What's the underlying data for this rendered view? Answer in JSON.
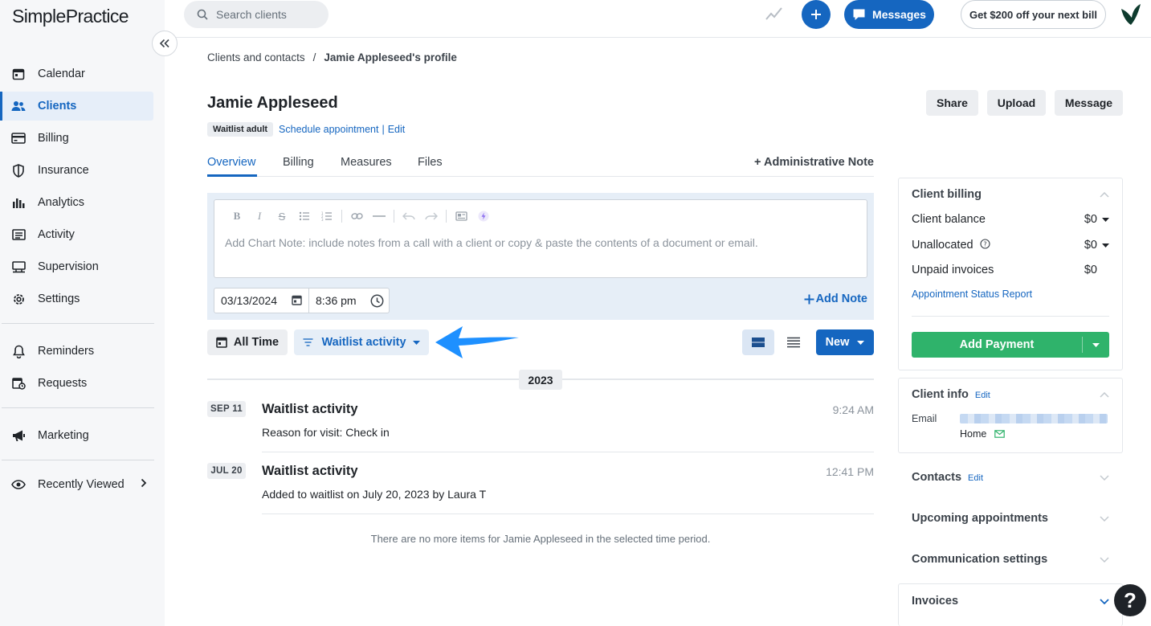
{
  "app": {
    "logo_text": "SimplePractice"
  },
  "topbar": {
    "search_placeholder": "Search clients",
    "messages_label": "Messages",
    "promo_label": "Get $200 off your next bill"
  },
  "sidebar": {
    "items": [
      {
        "label": "Calendar",
        "icon": "calendar-icon"
      },
      {
        "label": "Clients",
        "icon": "users-icon",
        "active": true
      },
      {
        "label": "Billing",
        "icon": "credit-card-icon"
      },
      {
        "label": "Insurance",
        "icon": "shield-icon"
      },
      {
        "label": "Analytics",
        "icon": "bar-chart-icon"
      },
      {
        "label": "Activity",
        "icon": "activity-list-icon"
      },
      {
        "label": "Supervision",
        "icon": "supervision-icon"
      },
      {
        "label": "Settings",
        "icon": "gear-icon"
      },
      {
        "label": "Reminders",
        "icon": "bell-icon"
      },
      {
        "label": "Requests",
        "icon": "requests-icon"
      },
      {
        "label": "Marketing",
        "icon": "megaphone-icon"
      },
      {
        "label": "Recently Viewed",
        "icon": "eye-icon"
      }
    ]
  },
  "breadcrumb": {
    "parent": "Clients and contacts",
    "separator": "/",
    "current": "Jamie Appleseed's profile"
  },
  "client": {
    "name": "Jamie Appleseed",
    "tag": "Waitlist adult",
    "schedule_link": "Schedule appointment",
    "edit_link": "Edit",
    "divider": "|"
  },
  "actions": {
    "share": "Share",
    "upload": "Upload",
    "message": "Message"
  },
  "tabs": [
    {
      "label": "Overview",
      "active": true
    },
    {
      "label": "Billing"
    },
    {
      "label": "Measures"
    },
    {
      "label": "Files"
    }
  ],
  "admin_note": "Administrative Note",
  "note": {
    "placeholder": "Add Chart Note: include notes from a call with a client or copy & paste the contents of a document or email.",
    "date": "03/13/2024",
    "time": "8:36 pm",
    "add_label": "Add Note"
  },
  "filters": {
    "all_time": "All Time",
    "waitlist": "Waitlist activity",
    "new": "New"
  },
  "timeline": {
    "year": "2023",
    "entries": [
      {
        "date": "SEP 11",
        "title": "Waitlist activity",
        "time": "9:24 AM",
        "desc": "Reason for visit: Check in"
      },
      {
        "date": "JUL 20",
        "title": "Waitlist activity",
        "time": "12:41 PM",
        "desc": "Added to waitlist on July 20, 2023 by Laura T"
      }
    ],
    "end_message": "There are no more items for Jamie Appleseed in the selected time period."
  },
  "billing_panel": {
    "title": "Client billing",
    "balance_label": "Client balance",
    "balance": "$0",
    "unallocated_label": "Unallocated",
    "unallocated": "$0",
    "unpaid_label": "Unpaid invoices",
    "unpaid": "$0",
    "report_link": "Appointment Status Report",
    "add_payment": "Add Payment"
  },
  "client_info": {
    "title": "Client info",
    "edit": "Edit",
    "email_label": "Email",
    "home_label": "Home"
  },
  "sections": {
    "contacts": "Contacts",
    "contacts_edit": "Edit",
    "upcoming": "Upcoming appointments",
    "communication": "Communication settings",
    "invoices": "Invoices"
  },
  "help": "?",
  "colors": {
    "brand_blue": "#1566c0",
    "payment_green": "#2fb36b",
    "annotation_arrow": "#1e90ff"
  }
}
